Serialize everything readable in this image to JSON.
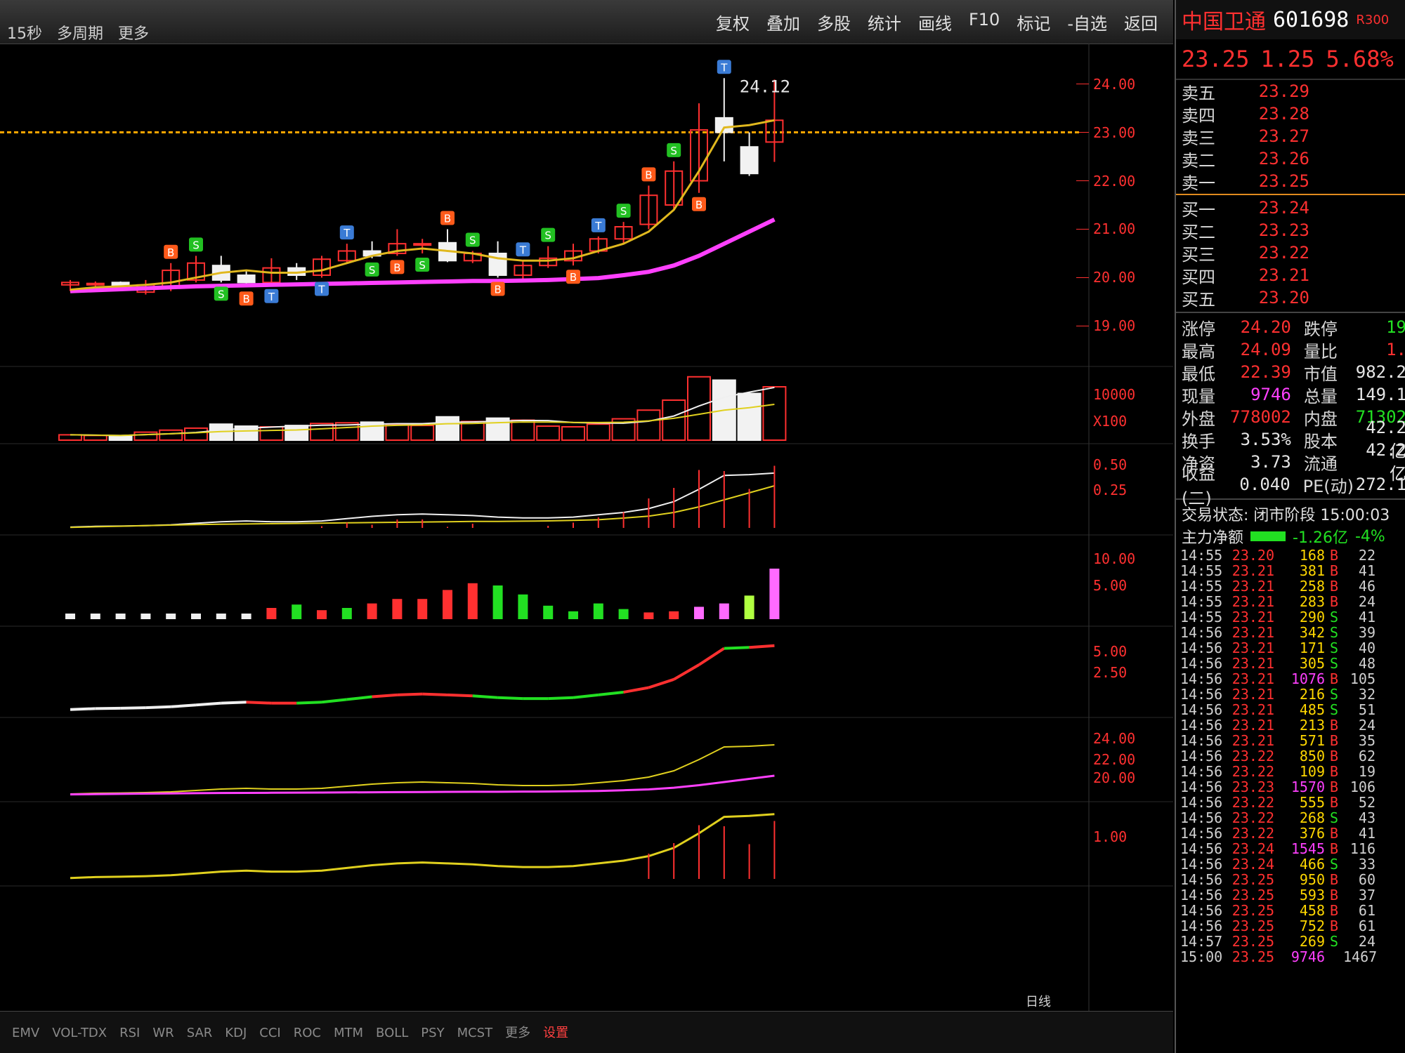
{
  "toolbar": {
    "left_items": [
      "15秒",
      "多周期",
      "更多"
    ],
    "buttons": [
      "复权",
      "叠加",
      "多股",
      "统计",
      "画线",
      "F10",
      "标记",
      "-自选",
      "返回"
    ]
  },
  "stock": {
    "name": "中国卫通",
    "code": "601698",
    "badge": "R300",
    "price": "23.25",
    "change": "1.25",
    "change_pct": "5.68%"
  },
  "order_book": {
    "asks": [
      {
        "label": "卖五",
        "price": "23.29"
      },
      {
        "label": "卖四",
        "price": "23.28"
      },
      {
        "label": "卖三",
        "price": "23.27"
      },
      {
        "label": "卖二",
        "price": "23.26"
      },
      {
        "label": "卖一",
        "price": "23.25"
      }
    ],
    "bids": [
      {
        "label": "买一",
        "price": "23.24"
      },
      {
        "label": "买二",
        "price": "23.23"
      },
      {
        "label": "买三",
        "price": "23.22"
      },
      {
        "label": "买四",
        "price": "23.21"
      },
      {
        "label": "买五",
        "price": "23.20"
      }
    ]
  },
  "stats": [
    {
      "l1": "涨停",
      "v1": "24.20",
      "c1": "red",
      "l2": "跌停",
      "v2": "19",
      "c2": "green"
    },
    {
      "l1": "最高",
      "v1": "24.09",
      "c1": "red",
      "l2": "量比",
      "v2": "1.",
      "c2": "red"
    },
    {
      "l1": "最低",
      "v1": "22.39",
      "c1": "red",
      "l2": "市值",
      "v2": "982.2",
      "c2": "white"
    },
    {
      "l1": "现量",
      "v1": "9746",
      "c1": "magenta",
      "l2": "总量",
      "v2": "149.1",
      "c2": "white"
    },
    {
      "l1": "外盘",
      "v1": "778002",
      "c1": "red",
      "l2": "内盘",
      "v2": "71302",
      "c2": "green"
    },
    {
      "l1": "换手",
      "v1": "3.53%",
      "c1": "white",
      "l2": "股本",
      "v2": "42.2亿",
      "c2": "white"
    },
    {
      "l1": "净资",
      "v1": "3.73",
      "c1": "white",
      "l2": "流通",
      "v2": "42.2亿",
      "c2": "white"
    },
    {
      "l1": "收益(二)",
      "v1": "0.040",
      "c1": "white",
      "l2": "PE(动)",
      "v2": "272.1",
      "c2": "white"
    }
  ],
  "trade_status": "交易状态: 闭市阶段 15:00:03",
  "main_flow": {
    "label": "主力净额",
    "value": "-1.26亿",
    "pct": "-4%"
  },
  "ticks": [
    {
      "t": "14:55",
      "p": "23.20",
      "v": "168",
      "d": "B",
      "n": "22"
    },
    {
      "t": "14:55",
      "p": "23.21",
      "v": "381",
      "d": "B",
      "n": "41"
    },
    {
      "t": "14:55",
      "p": "23.21",
      "v": "258",
      "d": "B",
      "n": "46"
    },
    {
      "t": "14:55",
      "p": "23.21",
      "v": "283",
      "d": "B",
      "n": "24"
    },
    {
      "t": "14:55",
      "p": "23.21",
      "v": "290",
      "d": "S",
      "n": "41"
    },
    {
      "t": "14:56",
      "p": "23.21",
      "v": "342",
      "d": "S",
      "n": "39"
    },
    {
      "t": "14:56",
      "p": "23.21",
      "v": "171",
      "d": "S",
      "n": "40"
    },
    {
      "t": "14:56",
      "p": "23.21",
      "v": "305",
      "d": "S",
      "n": "48"
    },
    {
      "t": "14:56",
      "p": "23.21",
      "v": "1076",
      "d": "B",
      "n": "105"
    },
    {
      "t": "14:56",
      "p": "23.21",
      "v": "216",
      "d": "S",
      "n": "32"
    },
    {
      "t": "14:56",
      "p": "23.21",
      "v": "485",
      "d": "S",
      "n": "51"
    },
    {
      "t": "14:56",
      "p": "23.21",
      "v": "213",
      "d": "B",
      "n": "24"
    },
    {
      "t": "14:56",
      "p": "23.21",
      "v": "571",
      "d": "B",
      "n": "35"
    },
    {
      "t": "14:56",
      "p": "23.22",
      "v": "850",
      "d": "B",
      "n": "62"
    },
    {
      "t": "14:56",
      "p": "23.22",
      "v": "109",
      "d": "B",
      "n": "19"
    },
    {
      "t": "14:56",
      "p": "23.23",
      "v": "1570",
      "d": "B",
      "n": "106"
    },
    {
      "t": "14:56",
      "p": "23.22",
      "v": "555",
      "d": "B",
      "n": "52"
    },
    {
      "t": "14:56",
      "p": "23.22",
      "v": "268",
      "d": "S",
      "n": "43"
    },
    {
      "t": "14:56",
      "p": "23.22",
      "v": "376",
      "d": "B",
      "n": "41"
    },
    {
      "t": "14:56",
      "p": "23.24",
      "v": "1545",
      "d": "B",
      "n": "116"
    },
    {
      "t": "14:56",
      "p": "23.24",
      "v": "466",
      "d": "S",
      "n": "33"
    },
    {
      "t": "14:56",
      "p": "23.25",
      "v": "950",
      "d": "B",
      "n": "60"
    },
    {
      "t": "14:56",
      "p": "23.25",
      "v": "593",
      "d": "B",
      "n": "37"
    },
    {
      "t": "14:56",
      "p": "23.25",
      "v": "458",
      "d": "B",
      "n": "61"
    },
    {
      "t": "14:56",
      "p": "23.25",
      "v": "752",
      "d": "B",
      "n": "61"
    },
    {
      "t": "14:57",
      "p": "23.25",
      "v": "269",
      "d": "S",
      "n": "24"
    },
    {
      "t": "15:00",
      "p": "23.25",
      "v": "9746",
      "d": "",
      "n": "1467"
    }
  ],
  "indicator_tabs": [
    "EMV",
    "VOL-TDX",
    "RSI",
    "WR",
    "SAR",
    "KDJ",
    "CCI",
    "ROC",
    "MTM",
    "BOLL",
    "PSY",
    "MCST",
    "更多",
    "设置"
  ],
  "period_label": "日线",
  "colors": {
    "up": "#ff3030",
    "down": "#22e022",
    "ma_short": "#e0b81e",
    "ma_long": "#ff40ff",
    "price_line": "#ffa500"
  },
  "chart_data": {
    "type": "candlestick",
    "price_axis": {
      "ticks": [
        "24.00",
        "23.00",
        "22.00",
        "21.00",
        "20.00",
        "19.00"
      ],
      "ylim": [
        18.6,
        24.4
      ]
    },
    "volume_axis": {
      "ticks": [
        "10000"
      ],
      "unit": "X100"
    },
    "indicator_axes": [
      [
        "0.50",
        "0.25"
      ],
      [
        "10.00",
        "5.00"
      ],
      [
        "5.00",
        "2.50"
      ],
      [
        "24.00",
        "22.00",
        "20.00"
      ],
      [
        "1.00"
      ]
    ],
    "last_price_line": 23.0,
    "high_annotation": "24.12",
    "candles": [
      {
        "o": 19.85,
        "h": 19.95,
        "l": 19.72,
        "c": 19.9
      },
      {
        "o": 19.85,
        "h": 19.92,
        "l": 19.78,
        "c": 19.88
      },
      {
        "o": 19.9,
        "h": 19.92,
        "l": 19.8,
        "c": 19.84
      },
      {
        "o": 19.7,
        "h": 19.95,
        "l": 19.65,
        "c": 19.85
      },
      {
        "o": 19.8,
        "h": 20.3,
        "l": 19.72,
        "c": 20.15
      },
      {
        "o": 19.95,
        "h": 20.45,
        "l": 19.9,
        "c": 20.3
      },
      {
        "o": 20.25,
        "h": 20.45,
        "l": 19.9,
        "c": 19.95
      },
      {
        "o": 20.05,
        "h": 20.15,
        "l": 19.8,
        "c": 19.9
      },
      {
        "o": 19.9,
        "h": 20.4,
        "l": 19.85,
        "c": 20.2
      },
      {
        "o": 20.2,
        "h": 20.3,
        "l": 19.95,
        "c": 20.05
      },
      {
        "o": 20.05,
        "h": 20.45,
        "l": 20.0,
        "c": 20.38
      },
      {
        "o": 20.35,
        "h": 20.7,
        "l": 20.3,
        "c": 20.55
      },
      {
        "o": 20.55,
        "h": 20.75,
        "l": 20.4,
        "c": 20.45
      },
      {
        "o": 20.5,
        "h": 21.0,
        "l": 20.45,
        "c": 20.7
      },
      {
        "o": 20.7,
        "h": 20.8,
        "l": 20.5,
        "c": 20.7
      },
      {
        "o": 20.72,
        "h": 21.0,
        "l": 20.32,
        "c": 20.35
      },
      {
        "o": 20.35,
        "h": 20.55,
        "l": 20.3,
        "c": 20.5
      },
      {
        "o": 20.5,
        "h": 20.75,
        "l": 20.0,
        "c": 20.05
      },
      {
        "o": 20.05,
        "h": 20.35,
        "l": 19.9,
        "c": 20.25
      },
      {
        "o": 20.25,
        "h": 20.65,
        "l": 20.2,
        "c": 20.4
      },
      {
        "o": 20.35,
        "h": 20.7,
        "l": 20.25,
        "c": 20.55
      },
      {
        "o": 20.55,
        "h": 20.85,
        "l": 20.5,
        "c": 20.8
      },
      {
        "o": 20.8,
        "h": 21.15,
        "l": 20.7,
        "c": 21.05
      },
      {
        "o": 21.1,
        "h": 21.9,
        "l": 21.0,
        "c": 21.7
      },
      {
        "o": 21.5,
        "h": 22.4,
        "l": 21.4,
        "c": 22.2
      },
      {
        "o": 22.0,
        "h": 23.6,
        "l": 21.75,
        "c": 23.05
      },
      {
        "o": 23.3,
        "h": 24.12,
        "l": 22.4,
        "c": 23.0
      },
      {
        "o": 22.7,
        "h": 23.0,
        "l": 22.1,
        "c": 22.15
      },
      {
        "o": 22.8,
        "h": 24.09,
        "l": 22.39,
        "c": 23.25
      }
    ],
    "ma_short": [
      19.75,
      19.8,
      19.82,
      19.85,
      19.9,
      20.0,
      20.1,
      20.15,
      20.1,
      20.1,
      20.15,
      20.3,
      20.45,
      20.55,
      20.6,
      20.55,
      20.5,
      20.4,
      20.35,
      20.35,
      20.4,
      20.55,
      20.7,
      20.95,
      21.4,
      22.2,
      23.1,
      23.15,
      23.25
    ],
    "ma_long": [
      19.72,
      19.74,
      19.76,
      19.78,
      19.8,
      19.82,
      19.83,
      19.84,
      19.85,
      19.86,
      19.87,
      19.88,
      19.89,
      19.9,
      19.91,
      19.92,
      19.93,
      19.93,
      19.94,
      19.95,
      19.97,
      19.99,
      20.05,
      20.12,
      20.25,
      20.45,
      20.7,
      20.95,
      21.2
    ],
    "volume": [
      8,
      7,
      6,
      12,
      15,
      18,
      24,
      21,
      20,
      22,
      25,
      26,
      27,
      24,
      22,
      35,
      28,
      33,
      30,
      21,
      20,
      24,
      32,
      45,
      60,
      95,
      90,
      70,
      80
    ],
    "mf_bars": [
      0.5,
      0.5,
      0.5,
      0.5,
      0.5,
      0.5,
      0.5,
      0.5,
      1.0,
      1.3,
      0.8,
      1.0,
      1.4,
      1.8,
      1.8,
      2.6,
      3.2,
      3.0,
      2.2,
      1.2,
      0.7,
      1.4,
      0.9,
      0.6,
      0.7,
      1.1,
      1.4,
      2.1,
      4.5
    ],
    "markers": [
      {
        "i": 4,
        "type": "B",
        "pos": "above"
      },
      {
        "i": 5,
        "type": "S",
        "pos": "above"
      },
      {
        "i": 6,
        "type": "S",
        "pos": "below"
      },
      {
        "i": 7,
        "type": "B",
        "pos": "below"
      },
      {
        "i": 8,
        "type": "T",
        "pos": "below"
      },
      {
        "i": 10,
        "type": "T",
        "pos": "below"
      },
      {
        "i": 11,
        "type": "T",
        "pos": "above"
      },
      {
        "i": 12,
        "type": "S",
        "pos": "below"
      },
      {
        "i": 13,
        "type": "B",
        "pos": "below"
      },
      {
        "i": 14,
        "type": "S",
        "pos": "below"
      },
      {
        "i": 15,
        "type": "B",
        "pos": "above"
      },
      {
        "i": 16,
        "type": "S",
        "pos": "above"
      },
      {
        "i": 17,
        "type": "B",
        "pos": "below"
      },
      {
        "i": 18,
        "type": "T",
        "pos": "above"
      },
      {
        "i": 19,
        "type": "S",
        "pos": "above"
      },
      {
        "i": 20,
        "type": "B",
        "pos": "below"
      },
      {
        "i": 21,
        "type": "T",
        "pos": "above"
      },
      {
        "i": 22,
        "type": "S",
        "pos": "above"
      },
      {
        "i": 23,
        "type": "B",
        "pos": "above"
      },
      {
        "i": 24,
        "type": "S",
        "pos": "above"
      },
      {
        "i": 25,
        "type": "B",
        "pos": "below"
      },
      {
        "i": 26,
        "type": "T",
        "pos": "above"
      }
    ]
  }
}
